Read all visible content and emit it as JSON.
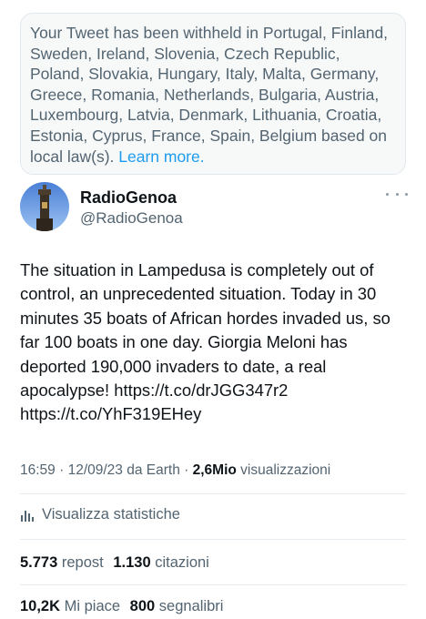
{
  "withheld_notice": {
    "text": "Your Tweet has been withheld in Portugal, Finland, Sweden, Ireland, Slovenia, Czech Republic, Poland, Slovakia, Hungary, Italy, Malta, Germany, Greece, Romania, Netherlands, Bulgaria, Austria, Luxembourg, Latvia, Denmark, Lithuania, Croatia, Estonia, Cyprus, France, Spain, Belgium based on local law(s). ",
    "link_label": "Learn more."
  },
  "author": {
    "name": "RadioGenoa",
    "handle": "@RadioGenoa"
  },
  "tweet": {
    "text": "The situation in Lampedusa is completely out of control, an unprecedented situation. Today in 30 minutes 35 boats of African hordes invaded us, so far 100 boats in one day. Giorgia Meloni has deported 190,000 invaders to date, a real apocalypse! https://t.co/drJGG347r2 https://t.co/YhF319EHey"
  },
  "meta": {
    "time": "16:59",
    "date": "12/09/23",
    "source": "da Earth",
    "views_count": "2,6Mio",
    "views_label": "visualizzazioni"
  },
  "stats_link": {
    "label": "Visualizza statistiche"
  },
  "engagement": {
    "reposts_count": "5.773",
    "reposts_label": "repost",
    "quotes_count": "1.130",
    "quotes_label": "citazioni",
    "likes_count": "10,2K",
    "likes_label": "Mi piace",
    "bookmarks_count": "800",
    "bookmarks_label": "segnalibri"
  },
  "colors": {
    "link": "#1d9bf0",
    "secondary_text": "#536471",
    "primary_text": "#0f1419"
  },
  "icons": {
    "more": "more-dots-icon",
    "stats": "bar-chart-icon"
  }
}
